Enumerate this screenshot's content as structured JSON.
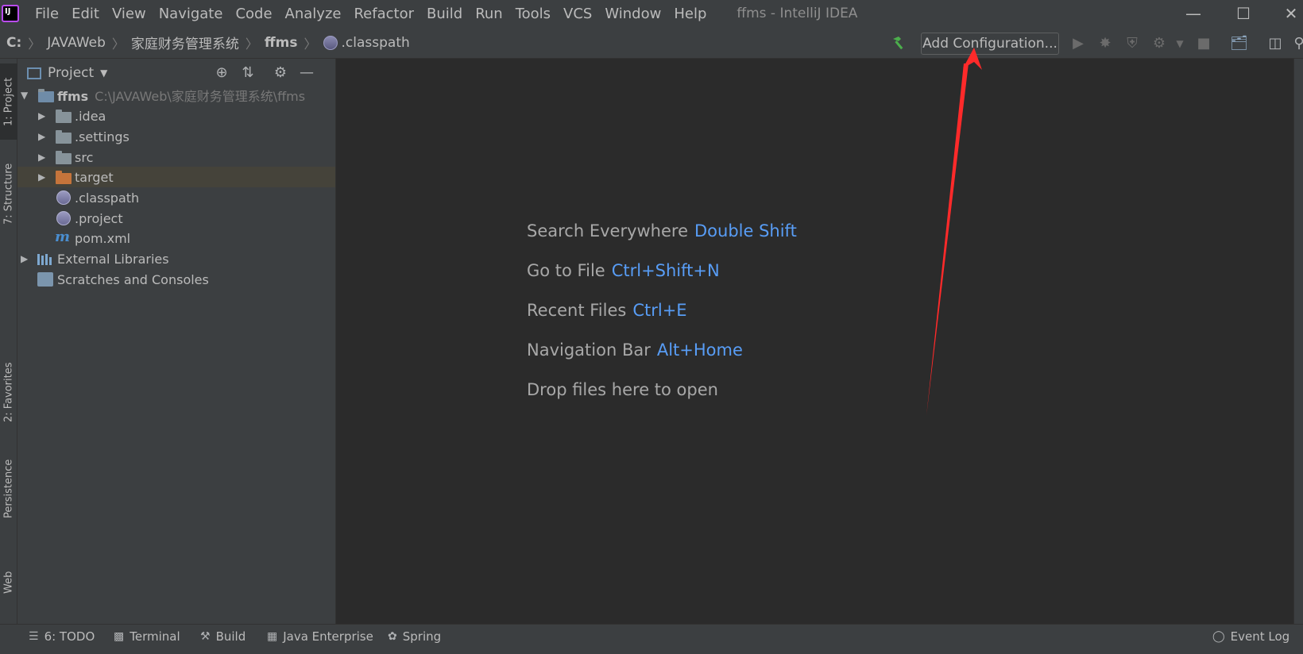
{
  "menu": [
    "File",
    "Edit",
    "View",
    "Navigate",
    "Code",
    "Analyze",
    "Refactor",
    "Build",
    "Run",
    "Tools",
    "VCS",
    "Window",
    "Help"
  ],
  "window_title": "ffms - IntelliJ IDEA",
  "breadcrumbs": [
    "C:",
    "JAVAWeb",
    "家庭财务管理系统",
    "ffms",
    ".classpath"
  ],
  "toolbar": {
    "add_configuration": "Add Configuration..."
  },
  "left_tabs": [
    "1: Project",
    "7: Structure",
    "2: Favorites",
    "Persistence",
    "Web"
  ],
  "project_panel": {
    "title": "Project",
    "root": {
      "name": "ffms",
      "path": "C:\\JAVAWeb\\家庭财务管理系统\\ffms"
    },
    "items": [
      ".idea",
      ".settings",
      "src",
      "target",
      ".classpath",
      ".project",
      "pom.xml",
      "External Libraries",
      "Scratches and Consoles"
    ]
  },
  "editor_hints": [
    {
      "label": "Search Everywhere",
      "key": "Double Shift"
    },
    {
      "label": "Go to File",
      "key": "Ctrl+Shift+N"
    },
    {
      "label": "Recent Files",
      "key": "Ctrl+E"
    },
    {
      "label": "Navigation Bar",
      "key": "Alt+Home"
    },
    {
      "label": "Drop files here to open",
      "key": ""
    }
  ],
  "bottom_tabs": [
    "6: TODO",
    "Terminal",
    "Build",
    "Java Enterprise",
    "Spring",
    "Event Log"
  ],
  "colors": {
    "accent_key": "#589df6",
    "annotation_arrow": "#ff2a2a",
    "build_hammer": "#4cae4c"
  }
}
